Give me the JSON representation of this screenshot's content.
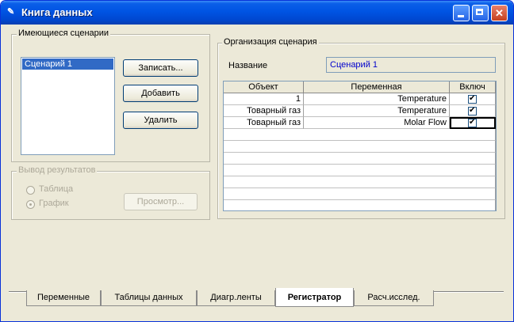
{
  "window": {
    "title": "Книга данных",
    "controls": {
      "minimize_icon": "minimize-icon",
      "maximize_icon": "maximize-icon",
      "close_icon": "close-icon",
      "close_glyph": "✕"
    },
    "app_icon_glyph": "✎"
  },
  "scenarios": {
    "group_label": "Имеющиеся сценарии",
    "items": [
      "Сценарий 1"
    ],
    "buttons": {
      "save": "Записать...",
      "add": "Добавить",
      "delete": "Удалить"
    }
  },
  "output": {
    "group_label": "Вывод результатов",
    "table_option": "Таблица",
    "graph_option": "График",
    "selected": "График",
    "view_button": "Просмотр..."
  },
  "organization": {
    "group_label": "Организация сценария",
    "name_label": "Название",
    "name_value": "Сценарий 1",
    "columns": [
      "Объект",
      "Переменная",
      "Включ"
    ],
    "rows": [
      {
        "object": "1",
        "variable": "Temperature",
        "included": true
      },
      {
        "object": "Товарный газ",
        "variable": "Temperature",
        "included": true
      },
      {
        "object": "Товарный газ",
        "variable": "Molar Flow",
        "included": true
      }
    ],
    "empty_rows": 8
  },
  "tabs": {
    "items": [
      "Переменные",
      "Таблицы данных",
      "Диагр.ленты",
      "Регистратор",
      "Расч.исслед."
    ],
    "active": "Регистратор"
  }
}
